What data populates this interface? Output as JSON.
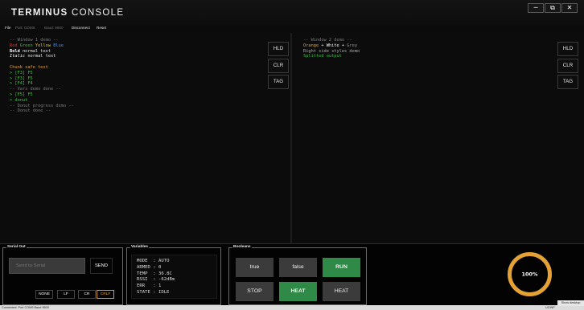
{
  "app": {
    "title_bold": "TERMINUS",
    "title_light": "CONSOLE",
    "minimize_icon": "minimize-icon",
    "restore_icon": "restore-icon",
    "close_icon": "close-icon"
  },
  "menu": {
    "file": "File",
    "port": "Port: COM9",
    "baud": "Baud: 9600",
    "disconnect": "Disconnect",
    "reset": "Reset"
  },
  "window1": {
    "lines": [
      {
        "text": "-- Window 1 demo --",
        "color": "#7a7a7a"
      },
      {
        "segments": [
          {
            "text": "Red ",
            "color": "#d13b3b"
          },
          {
            "text": "Green ",
            "color": "#39c43f"
          },
          {
            "text": "Yellow ",
            "color": "#e8c442"
          },
          {
            "text": "Blue",
            "color": "#4f8ee8"
          }
        ]
      },
      {
        "segments": [
          {
            "text": "Bold",
            "color": "#ffffff",
            "bold": true
          },
          {
            "text": " normal text",
            "color": "#e8e8e8"
          }
        ]
      },
      {
        "segments": [
          {
            "text": "Italic",
            "color": "#ffffff",
            "italic": true
          },
          {
            "text": " normal text",
            "color": "#e8e8e8"
          }
        ]
      },
      {
        "text": "",
        "color": "#e8e8e8"
      },
      {
        "text": "Chunk safe test",
        "color": "#e8a23a"
      },
      {
        "text": "> [F3] F5",
        "color": "#39c43f"
      },
      {
        "text": "> [F3] F5",
        "color": "#39c43f"
      },
      {
        "text": "> [F4] F4",
        "color": "#39c43f"
      },
      {
        "text": "-- Vars demo done --",
        "color": "#7a7a7a"
      },
      {
        "text": "> [F5] F5",
        "color": "#39c43f"
      },
      {
        "text": "> donut",
        "color": "#39c43f"
      },
      {
        "text": "-- Donut progress demo --",
        "color": "#7a7a7a"
      },
      {
        "text": "-- Donut done --",
        "color": "#7a7a7a"
      }
    ],
    "buttons": {
      "hold": "HLD",
      "clear": "CLR",
      "tag": "TAG"
    }
  },
  "window2": {
    "lines": [
      {
        "text": "-- Window 2 demo --",
        "color": "#7a7a7a"
      },
      {
        "segments": [
          {
            "text": "Orange",
            "color": "#e8a23a"
          },
          {
            "text": " + ",
            "color": "#e8e8e8"
          },
          {
            "text": "White",
            "color": "#ffffff"
          },
          {
            "text": " + ",
            "color": "#e8e8e8"
          },
          {
            "text": "Grey",
            "color": "#9a9a9a"
          }
        ]
      },
      {
        "text": "Right side styles demo",
        "color": "#aaaaaa"
      },
      {
        "text": "Splitted output",
        "color": "#39c43f"
      }
    ],
    "buttons": {
      "hold": "HLD",
      "clear": "CLR",
      "tag": "TAG"
    }
  },
  "serial_out": {
    "title": "Serial Out",
    "placeholder": "Send to Serial",
    "send_label": "SEND",
    "line_endings": [
      "NONE",
      "LF",
      "CR",
      "CRLF"
    ],
    "selected_line_ending": "CRLF",
    "accent": "#e8a23a"
  },
  "variables": {
    "title": "Variables",
    "rows": [
      {
        "name": "MODE",
        "value": "AUTO"
      },
      {
        "name": "ARMED",
        "value": "0"
      },
      {
        "name": "TEMP",
        "value": "36.8C"
      },
      {
        "name": "RSSI",
        "value": "-62dBm"
      },
      {
        "name": "ERR",
        "value": "1"
      },
      {
        "name": "STATE",
        "value": "IDLE"
      }
    ]
  },
  "booleans": {
    "title": "Booleans",
    "buttons": [
      {
        "label": "true",
        "on": false
      },
      {
        "label": "false",
        "on": false
      },
      {
        "label": "RUN",
        "on": true
      },
      {
        "label": "STOP",
        "on": false
      },
      {
        "label": "HEAT",
        "on": true
      },
      {
        "label": "HEAT",
        "on": false
      }
    ],
    "on_color": "#2f8a47",
    "off_color": "#3b3b3b"
  },
  "gauge": {
    "value": 100,
    "label": "100%",
    "color": "#e3a233"
  },
  "status": {
    "text": "Connected: Port COM9 Baud 9600",
    "right_text": "UCINP",
    "show_desktop": "Show desktop"
  }
}
